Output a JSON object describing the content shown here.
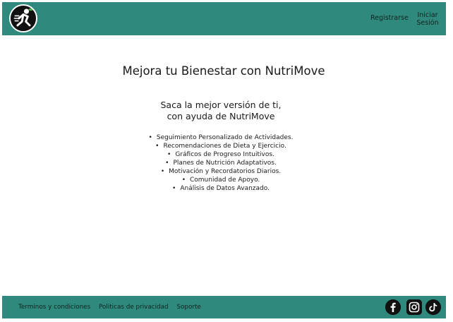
{
  "header": {
    "register_label": "Registrarse",
    "login_label": "Iniciar Sesión",
    "logo_icon": "runner-logo-icon"
  },
  "main": {
    "title": "Mejora tu Bienestar con NutriMove",
    "subtitle_line1": "Saca la mejor versión de ti,",
    "subtitle_line2": "con ayuda de NutriMove",
    "bullet": "•",
    "features": [
      "Seguimiento Personalizado de Actividades.",
      "Recomendaciones de Dieta y Ejercicio.",
      "Gráficos de Progreso Intuitivos.",
      "Planes de Nutrición Adaptativos.",
      "Motivación y Recordatorios Diarios.",
      "Comunidad de Apoyo.",
      "Análisis de Datos Avanzado."
    ]
  },
  "footer": {
    "links": [
      "Terminos y condiciones",
      "Politicas de privacidad",
      "Soporte"
    ],
    "social_icons": [
      "facebook-icon",
      "instagram-icon",
      "tiktok-icon"
    ]
  },
  "colors": {
    "brand_teal": "#2f8a7d",
    "text_dark": "#1a1a1a",
    "icon_dark": "#111111"
  }
}
